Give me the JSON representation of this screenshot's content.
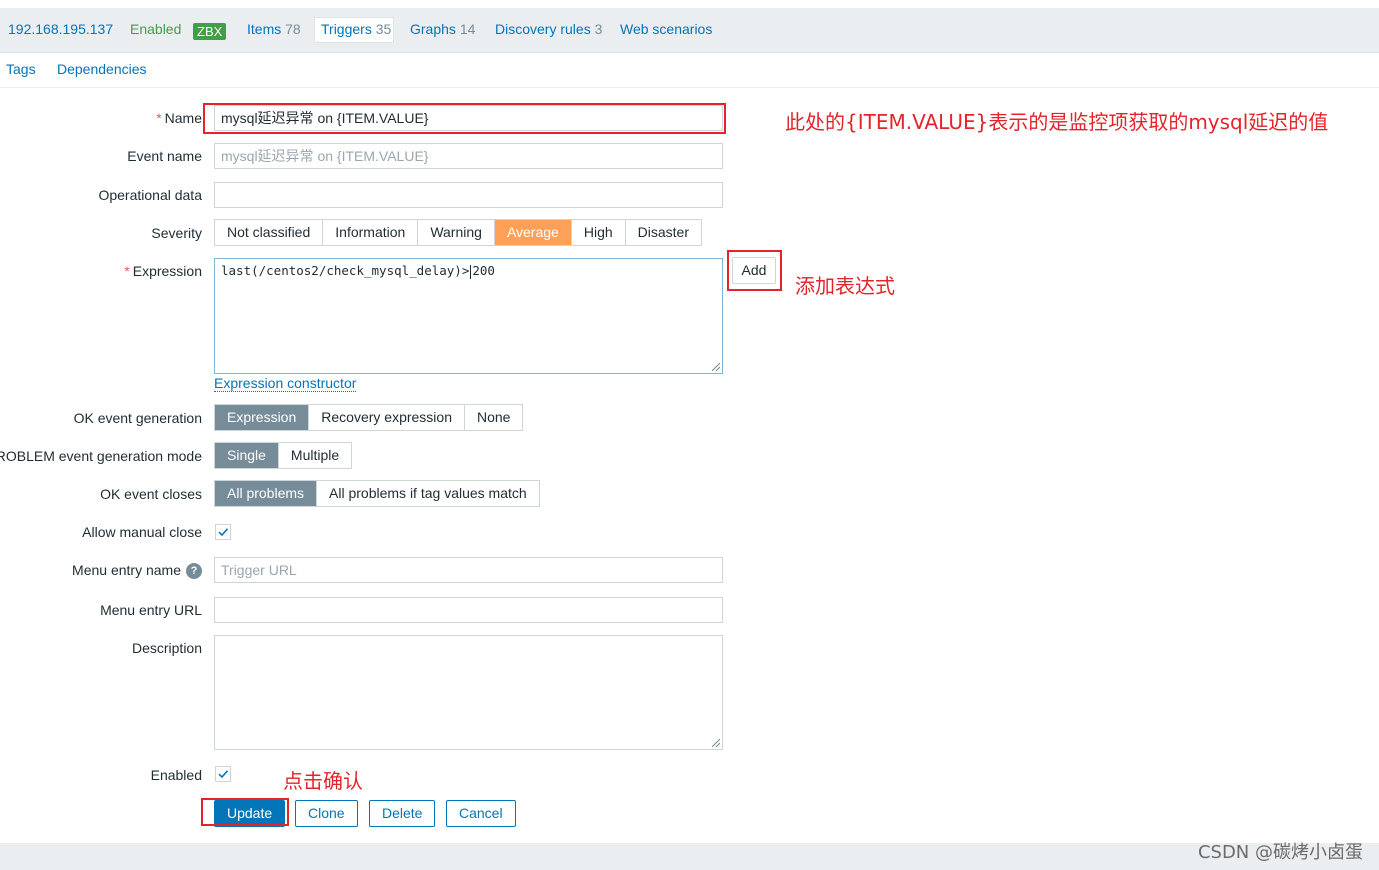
{
  "host_nav": {
    "host": "192.168.195.137",
    "status": "Enabled",
    "zbx_badge": "ZBX",
    "items_label": "Items",
    "items_count": "78",
    "triggers_label": "Triggers",
    "triggers_count": "35",
    "graphs_label": "Graphs",
    "graphs_count": "14",
    "discovery_label": "Discovery rules",
    "discovery_count": "3",
    "web_label": "Web scenarios"
  },
  "sub_tabs": {
    "tags": "Tags",
    "dependencies": "Dependencies"
  },
  "form": {
    "name_label": "Name",
    "name_value": "mysql延迟异常  on {ITEM.VALUE}",
    "event_name_label": "Event name",
    "event_name_placeholder": "mysql延迟异常  on {ITEM.VALUE}",
    "operational_label": "Operational data",
    "severity_label": "Severity",
    "severity_options": [
      "Not classified",
      "Information",
      "Warning",
      "Average",
      "High",
      "Disaster"
    ],
    "severity_selected": "Average",
    "expression_label": "Expression",
    "expression_before_caret": "last(/centos2/check_mysql_delay)>",
    "expression_after_caret": "200",
    "add_button": "Add",
    "expression_constructor": "Expression constructor",
    "ok_event_generation_label": "OK event generation",
    "ok_event_generation_options": [
      "Expression",
      "Recovery expression",
      "None"
    ],
    "problem_mode_label": "PROBLEM event generation mode",
    "problem_mode_options": [
      "Single",
      "Multiple"
    ],
    "ok_event_closes_label": "OK event closes",
    "ok_event_closes_options": [
      "All problems",
      "All problems if tag values match"
    ],
    "allow_manual_close_label": "Allow manual close",
    "menu_entry_name_label": "Menu entry name",
    "help_glyph": "?",
    "menu_entry_name_placeholder": "Trigger URL",
    "menu_entry_url_label": "Menu entry URL",
    "description_label": "Description",
    "enabled_label": "Enabled"
  },
  "actions": {
    "update": "Update",
    "clone": "Clone",
    "delete": "Delete",
    "cancel": "Cancel"
  },
  "annotations": {
    "name_note": "此处的{ITEM.VALUE}表示的是监控项获取的mysql延迟的值",
    "add_note": "添加表达式",
    "confirm_note": "点击确认"
  },
  "watermark": "CSDN @碳烤小卤蛋",
  "colors": {
    "link": "#0275b8",
    "enabled_green": "#429e47",
    "severity_average": "#ffa059",
    "selected_gray": "#768d99",
    "annotation_red": "#e3242b"
  }
}
